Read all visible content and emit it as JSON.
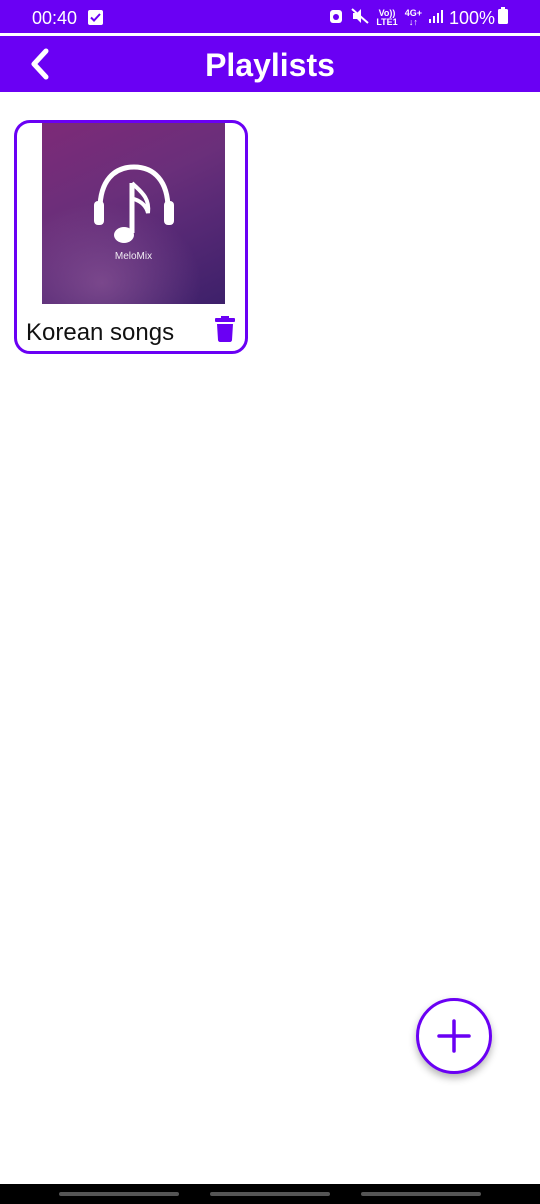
{
  "status_bar": {
    "time": "00:40",
    "network_label_top": "Vo))",
    "network_label_bottom": "LTE1",
    "network_type": "4G+",
    "battery": "100%",
    "icons": [
      "notification-check-icon",
      "alarm-icon",
      "mute-icon",
      "signal-icon",
      "battery-icon"
    ]
  },
  "app_bar": {
    "title": "Playlists",
    "back_icon": "chevron-left-icon"
  },
  "playlists": [
    {
      "name": "Korean songs",
      "cover_brand": "MeloMix",
      "cover_icon": "headphones-music-note-icon",
      "delete_icon": "trash-icon"
    }
  ],
  "fab": {
    "icon": "plus-icon"
  },
  "colors": {
    "primary": "#6a00f4",
    "background": "#ffffff",
    "text": "#111111"
  }
}
